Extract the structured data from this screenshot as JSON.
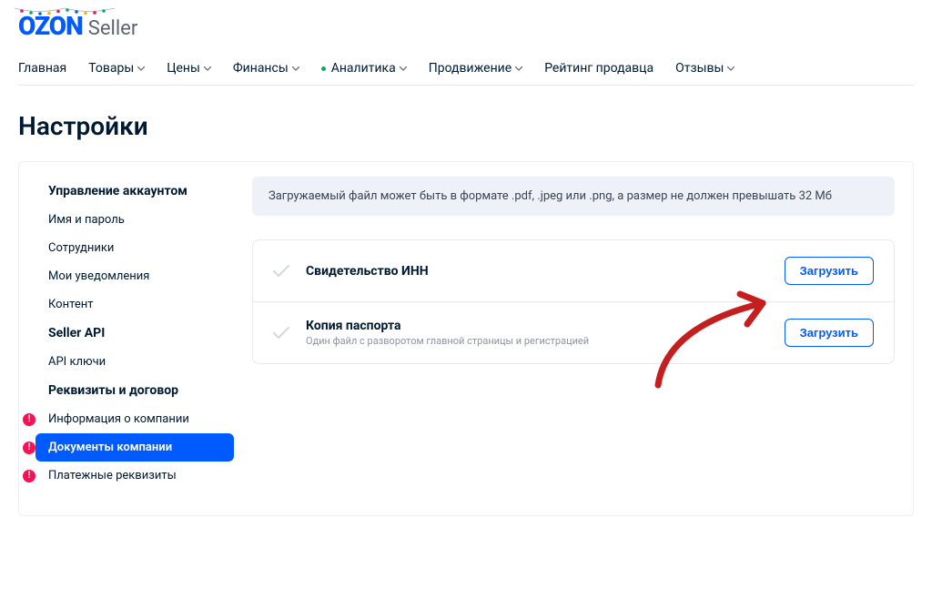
{
  "logo": {
    "ozon": "OZON",
    "seller": "Seller"
  },
  "nav": {
    "main": "Главная",
    "products": "Товары",
    "prices": "Цены",
    "finance": "Финансы",
    "analytics": "Аналитика",
    "promotion": "Продвижение",
    "seller_rating": "Рейтинг продавца",
    "reviews": "Отзывы"
  },
  "page_title": "Настройки",
  "sidebar": {
    "account_section": "Управление аккаунтом",
    "login_password": "Имя и пароль",
    "employees": "Сотрудники",
    "notifications": "Мои уведомления",
    "content": "Контент",
    "seller_api_section": "Seller API",
    "api_keys": "API ключи",
    "requisites_section": "Реквизиты и договор",
    "company_info": "Информация о компании",
    "company_docs": "Документы компании",
    "payment_details": "Платежные реквизиты"
  },
  "banner_text": "Загружаемый файл может быть в формате .pdf, .jpeg или .png, а размер не должен превышать 32 Мб",
  "docs": {
    "inn_title": "Свидетельство ИНН",
    "passport_title": "Копия паспорта",
    "passport_subtitle": "Один файл с разворотом главной страницы и регистрацией"
  },
  "upload_button": "Загрузить"
}
